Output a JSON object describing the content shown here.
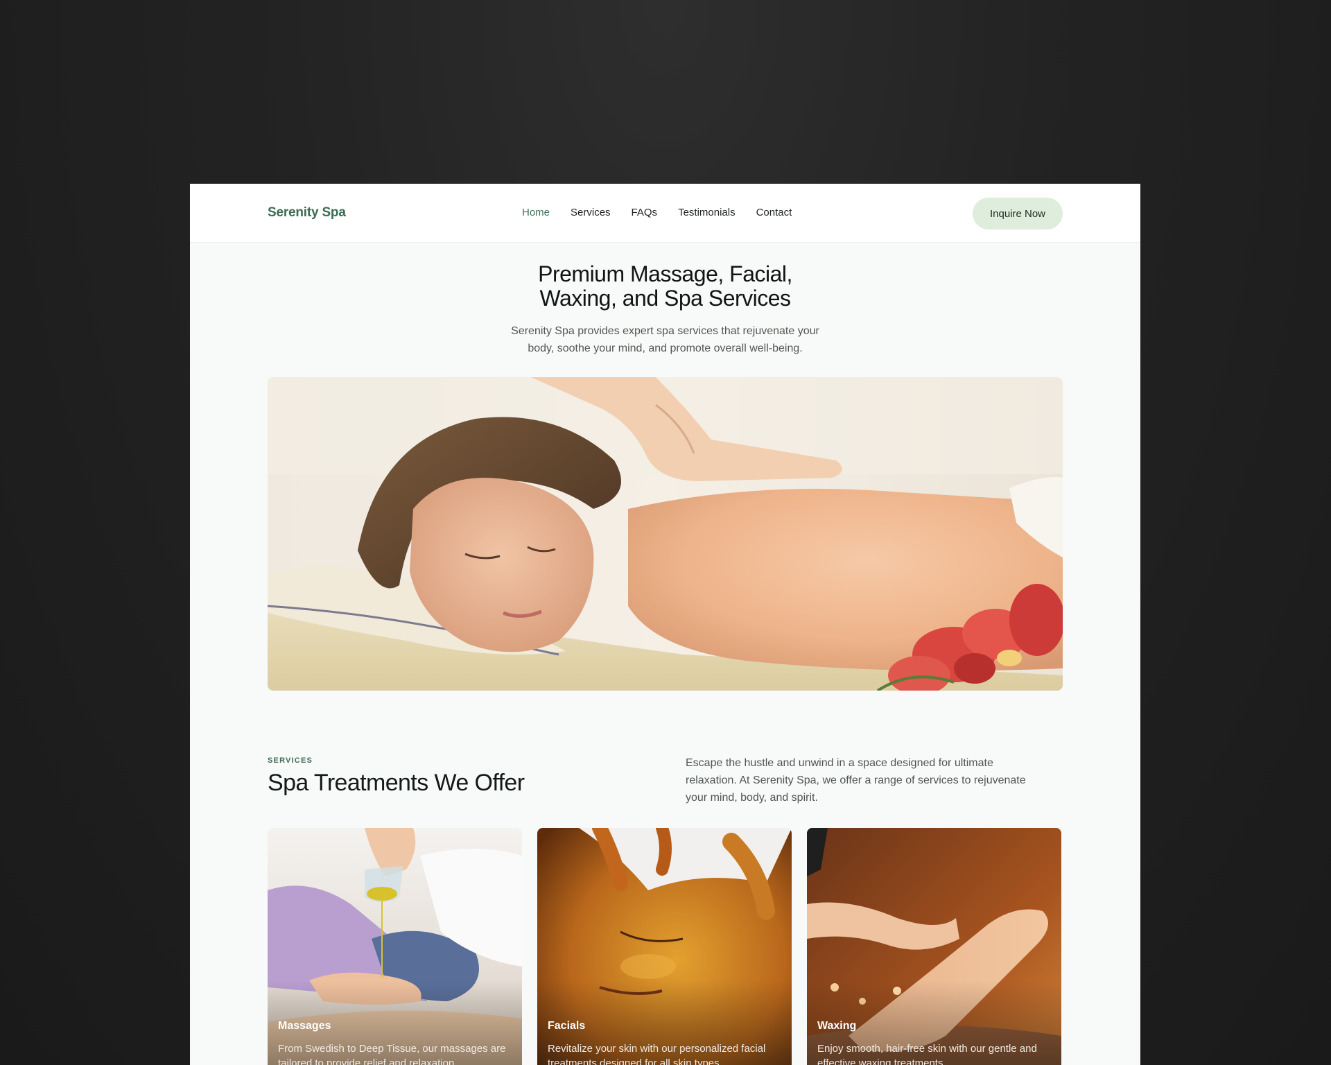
{
  "nav": {
    "brand": "Serenity Spa",
    "links": [
      {
        "label": "Home",
        "active": true
      },
      {
        "label": "Services",
        "active": false
      },
      {
        "label": "FAQs",
        "active": false
      },
      {
        "label": "Testimonials",
        "active": false
      },
      {
        "label": "Contact",
        "active": false
      }
    ],
    "cta_label": "Inquire Now"
  },
  "hero": {
    "title_line1": "Premium Massage, Facial,",
    "title_line2": "Waxing, and Spa Services",
    "subtitle_line1": "Serenity Spa provides expert spa services that rejuvenate your",
    "subtitle_line2": "body, soothe your mind, and promote overall well-being."
  },
  "services": {
    "eyebrow": "SERVICES",
    "title": "Spa Treatments We Offer",
    "description": "Escape the hustle and unwind in a space designed for ultimate relaxation. At Serenity Spa, we offer a range of services to rejuvenate your mind, body, and spirit.",
    "cards": [
      {
        "title": "Massages",
        "text": "From Swedish to Deep Tissue, our massages are tailored to provide relief and relaxation."
      },
      {
        "title": "Facials",
        "text": "Revitalize your skin with our personalized facial treatments designed for all skin types."
      },
      {
        "title": "Waxing",
        "text": "Enjoy smooth, hair-free skin with our gentle and effective waxing treatments."
      }
    ]
  },
  "colors": {
    "brand_green": "#3d6b52",
    "cta_bg": "#dfeedc",
    "page_bg": "#f8fafa",
    "backdrop": "#1f1f1f"
  }
}
